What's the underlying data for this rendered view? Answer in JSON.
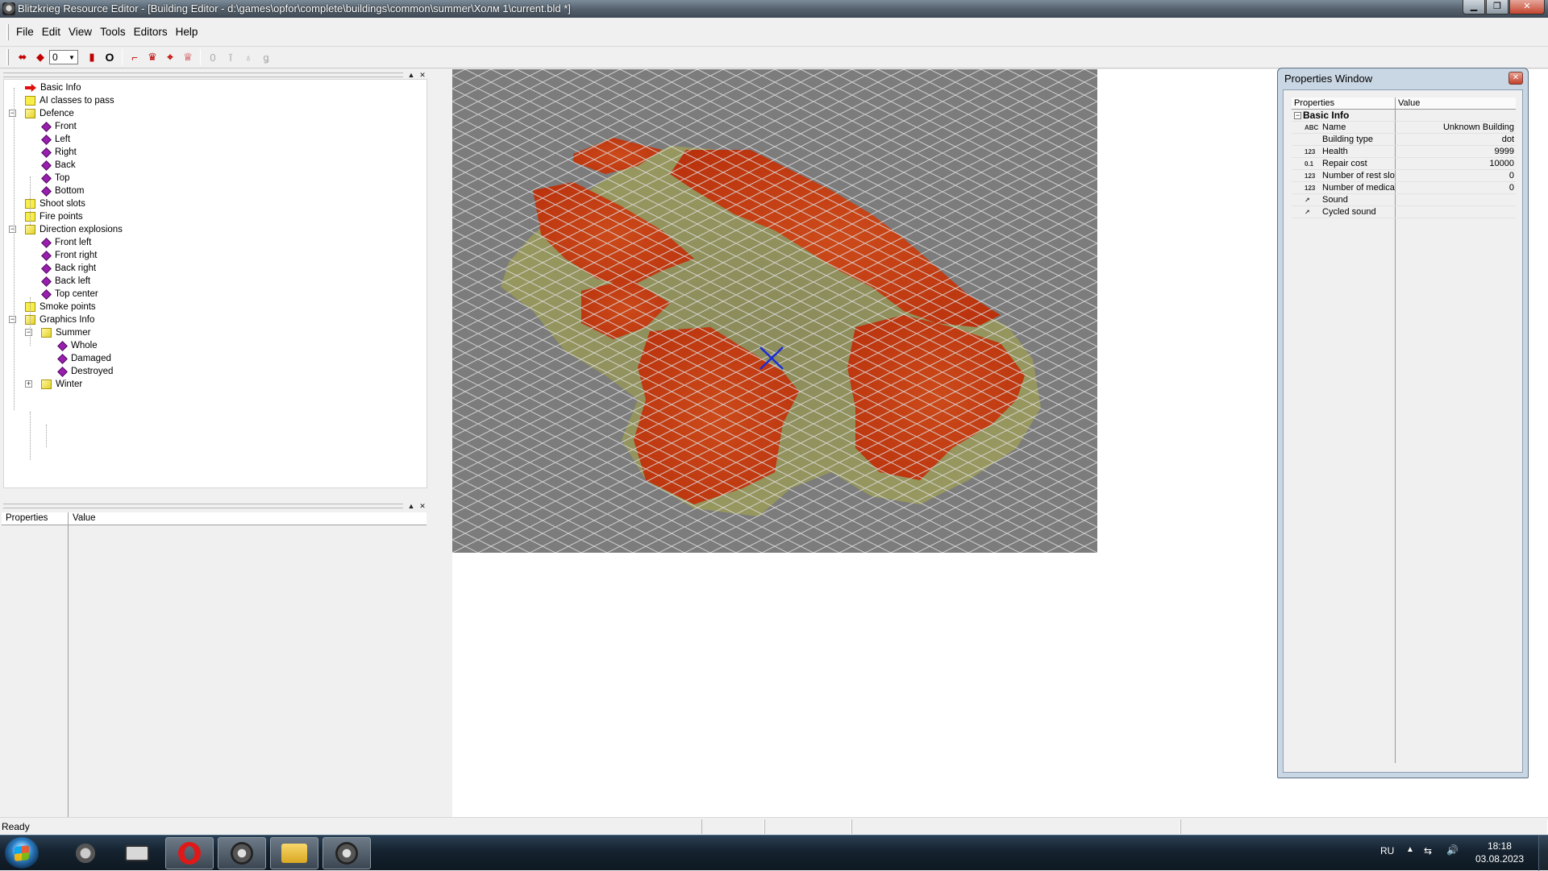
{
  "window": {
    "title": "Blitzkrieg Resource Editor - [Building Editor - d:\\games\\opfor\\complete\\buildings\\common\\summer\\Холм 1\\current.bld *]",
    "caption_buttons": [
      "minimize",
      "restore",
      "close"
    ]
  },
  "menu": [
    {
      "label": "File"
    },
    {
      "label": "Edit"
    },
    {
      "label": "View"
    },
    {
      "label": "Tools"
    },
    {
      "label": "Editors"
    },
    {
      "label": "Help"
    }
  ],
  "toolbar": {
    "combo_value": "0",
    "buttons": [
      {
        "icon": "double-arrow-icon"
      },
      {
        "icon": "diamond-icon"
      },
      {
        "icon": "flag-icon"
      },
      {
        "icon": "zero-icon"
      },
      {
        "icon": "gun-icon"
      },
      {
        "icon": "crown-icon"
      },
      {
        "icon": "target-icon"
      },
      {
        "icon": "crown-x-icon"
      },
      {
        "icon": "zero-gray-icon"
      },
      {
        "icon": "figure-gray-icon"
      },
      {
        "icon": "drop-gray-icon"
      },
      {
        "icon": "hook-gray-icon"
      }
    ]
  },
  "tree": {
    "items": [
      {
        "label": "Basic Info",
        "icon": "arrow-red-icon",
        "level": 0
      },
      {
        "label": "AI classes to pass",
        "icon": "folder-icon",
        "level": 0
      },
      {
        "label": "Defence",
        "icon": "folder-open-icon",
        "level": 0,
        "expanded": true
      },
      {
        "label": "Front",
        "icon": "diamond-icon",
        "level": 1
      },
      {
        "label": "Left",
        "icon": "diamond-icon",
        "level": 1
      },
      {
        "label": "Right",
        "icon": "diamond-icon",
        "level": 1
      },
      {
        "label": "Back",
        "icon": "diamond-icon",
        "level": 1
      },
      {
        "label": "Top",
        "icon": "diamond-icon",
        "level": 1
      },
      {
        "label": "Bottom",
        "icon": "diamond-icon",
        "level": 1
      },
      {
        "label": "Shoot slots",
        "icon": "folder-icon",
        "level": 0
      },
      {
        "label": "Fire points",
        "icon": "folder-icon",
        "level": 0
      },
      {
        "label": "Direction explosions",
        "icon": "folder-open-icon",
        "level": 0,
        "expanded": true
      },
      {
        "label": "Front left",
        "icon": "diamond-icon",
        "level": 1
      },
      {
        "label": "Front right",
        "icon": "diamond-icon",
        "level": 1
      },
      {
        "label": "Back right",
        "icon": "diamond-icon",
        "level": 1
      },
      {
        "label": "Back left",
        "icon": "diamond-icon",
        "level": 1
      },
      {
        "label": "Top center",
        "icon": "diamond-icon",
        "level": 1
      },
      {
        "label": "Smoke points",
        "icon": "folder-icon",
        "level": 0
      },
      {
        "label": "Graphics Info",
        "icon": "folder-open-icon",
        "level": 0,
        "expanded": true
      },
      {
        "label": "Summer",
        "icon": "folder-open-icon",
        "level": 1,
        "expanded": true
      },
      {
        "label": "Whole",
        "icon": "diamond-icon",
        "level": 2
      },
      {
        "label": "Damaged",
        "icon": "diamond-icon",
        "level": 2
      },
      {
        "label": "Destroyed",
        "icon": "diamond-icon",
        "level": 2
      },
      {
        "label": "Winter",
        "icon": "folder-open-icon",
        "level": 1,
        "expanded": false
      }
    ]
  },
  "left_properties": {
    "col_properties": "Properties",
    "col_value": "Value"
  },
  "properties_window": {
    "title": "Properties Window",
    "col_properties": "Properties",
    "col_value": "Value",
    "group": "Basic Info",
    "rows": [
      {
        "type": "ABC",
        "name": "Name",
        "value": "Unknown Building"
      },
      {
        "type": "",
        "name": "Building type",
        "value": "dot"
      },
      {
        "type": "123",
        "name": "Health",
        "value": "9999"
      },
      {
        "type": "0.1",
        "name": "Repair cost",
        "value": "10000"
      },
      {
        "type": "123",
        "name": "Number of rest slot",
        "value": "0"
      },
      {
        "type": "123",
        "name": "Number of medical",
        "value": "0"
      },
      {
        "type": "↗",
        "name": "Sound",
        "value": ""
      },
      {
        "type": "↗",
        "name": "Cycled sound",
        "value": ""
      }
    ]
  },
  "status": {
    "text": "Ready"
  },
  "taskbar": {
    "language": "RU",
    "time": "18:18",
    "date": "03.08.2023",
    "apps": [
      {
        "icon": "speaker-app-icon"
      },
      {
        "icon": "camera-app-icon"
      },
      {
        "icon": "opera-app-icon"
      },
      {
        "icon": "blitzkrieg-app-icon"
      },
      {
        "icon": "explorer-app-icon"
      },
      {
        "icon": "blitzkrieg-editor-app-icon"
      }
    ]
  },
  "colors": {
    "tile_red": "#c23a12",
    "tile_olive": "#8e8e58",
    "grid_line": "#d8d8d8",
    "cursor_blue": "#1b2bd6"
  }
}
